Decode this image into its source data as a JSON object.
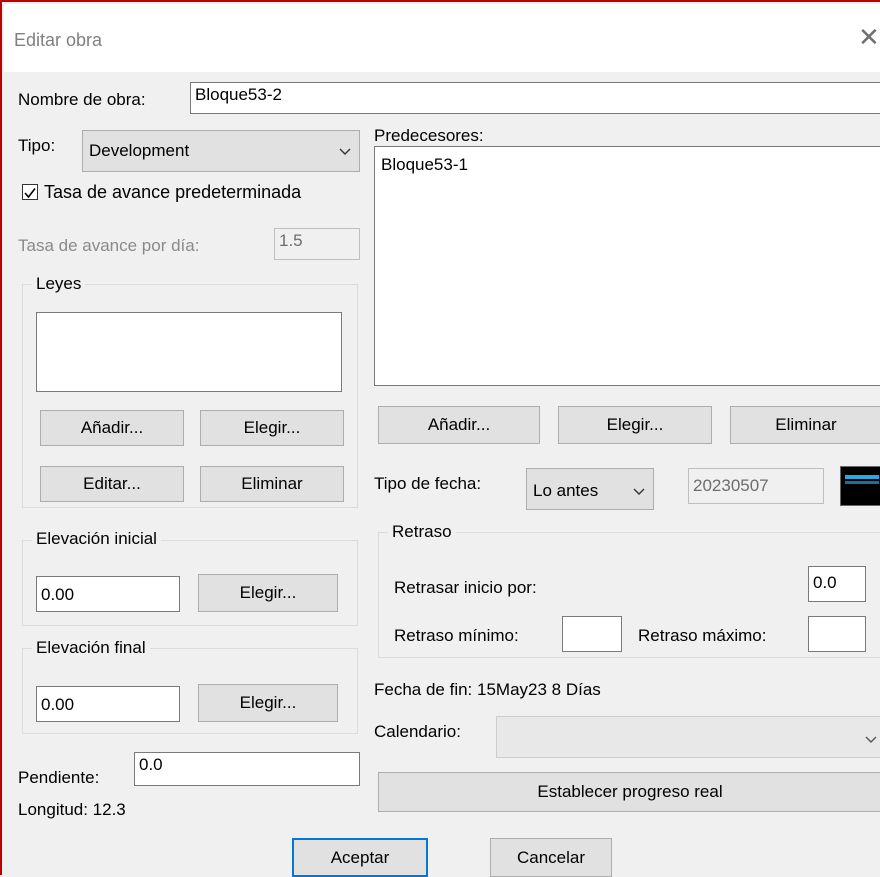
{
  "window": {
    "title": "Editar obra",
    "close_glyph": "✕"
  },
  "nombre": {
    "label": "Nombre de obra:",
    "value": "Bloque53-2"
  },
  "tipo": {
    "label": "Tipo:",
    "value": "Development"
  },
  "tasa_default": {
    "label": "Tasa de avance predeterminada",
    "checked": true
  },
  "tasa_dia": {
    "label": "Tasa de avance por día:",
    "value": "1.5"
  },
  "leyes": {
    "label": "Leyes",
    "add": "Añadir...",
    "choose": "Elegir...",
    "edit": "Editar...",
    "remove": "Eliminar"
  },
  "elev_inicial": {
    "label": "Elevación inicial",
    "value": "0.00",
    "choose": "Elegir..."
  },
  "elev_final": {
    "label": "Elevación final",
    "value": "0.00",
    "choose": "Elegir..."
  },
  "pendiente": {
    "label": "Pendiente:",
    "value": "0.0"
  },
  "longitud": {
    "text": "Longitud: 12.3"
  },
  "predecesores": {
    "label": "Predecesores:",
    "items": [
      "Bloque53-1"
    ],
    "add": "Añadir...",
    "choose": "Elegir...",
    "remove": "Eliminar"
  },
  "tipo_fecha": {
    "label": "Tipo de fecha:",
    "value": "Lo antes",
    "date": "20230507"
  },
  "retraso": {
    "label": "Retraso",
    "inicio_label": "Retrasar inicio por:",
    "inicio_value": "0.0",
    "min_label": "Retraso mínimo:",
    "min_value": "",
    "max_label": "Retraso máximo:",
    "max_value": ""
  },
  "fecha_fin": {
    "text": "Fecha de fin: 15May23  8 Días"
  },
  "calendario": {
    "label": "Calendario:",
    "value": ""
  },
  "progreso_button": "Establecer progreso real",
  "footer": {
    "ok": "Aceptar",
    "cancel": "Cancelar"
  },
  "icons": [
    "close-icon",
    "chevron-down-icon",
    "checkmark-icon",
    "calendar-icon"
  ],
  "colors": {
    "focus_border": "#0078d7",
    "window_border": "#c00000",
    "calendar_icon_bg": "#000000",
    "calendar_icon_fg": "#2aa9e0"
  }
}
